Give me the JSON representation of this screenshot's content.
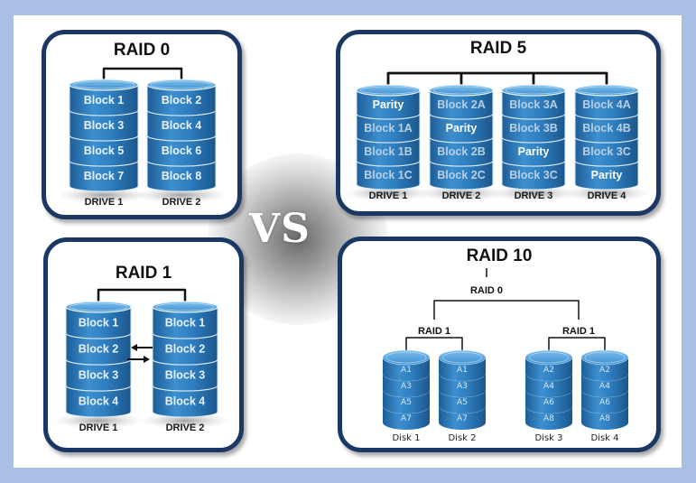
{
  "vs_label": "VS",
  "colors": {
    "frame": "#a9bfe3",
    "box_border": "#1b3864",
    "cylinder_body": "#2f7fc0",
    "cylinder_light": "#5ba7de",
    "cylinder_dark": "#1b5f98",
    "parity_text": "#ffffff",
    "block_text_raid5": "#b9cfe3"
  },
  "raid0": {
    "title": "RAID 0",
    "drives": [
      {
        "label": "DRIVE 1",
        "blocks": [
          "Block 1",
          "Block 3",
          "Block 5",
          "Block 7"
        ]
      },
      {
        "label": "DRIVE 2",
        "blocks": [
          "Block 2",
          "Block 4",
          "Block 6",
          "Block 8"
        ]
      }
    ]
  },
  "raid5": {
    "title": "RAID 5",
    "drives": [
      {
        "label": "DRIVE 1",
        "blocks": [
          "Parity",
          "Block 1A",
          "Block 1B",
          "Block 1C"
        ]
      },
      {
        "label": "DRIVE 2",
        "blocks": [
          "Block 2A",
          "Parity",
          "Block 2B",
          "Block 2C"
        ]
      },
      {
        "label": "DRIVE 3",
        "blocks": [
          "Block 3A",
          "Block 3B",
          "Parity",
          "Block 3C"
        ]
      },
      {
        "label": "DRIVE 4",
        "blocks": [
          "Block 4A",
          "Block 4B",
          "Block 3C",
          "Parity"
        ]
      }
    ]
  },
  "raid1": {
    "title": "RAID 1",
    "drives": [
      {
        "label": "DRIVE 1",
        "blocks": [
          "Block 1",
          "Block 2",
          "Block 3",
          "Block 4"
        ]
      },
      {
        "label": "DRIVE 2",
        "blocks": [
          "Block 1",
          "Block 2",
          "Block 3",
          "Block 4"
        ]
      }
    ],
    "arrows": [
      "left-arrow",
      "right-arrow"
    ]
  },
  "raid10": {
    "title": "RAID 10",
    "stripe_label": "RAID 0",
    "mirror_labels": [
      "RAID 1",
      "RAID 1"
    ],
    "disks": [
      {
        "label": "Disk 1",
        "blocks": [
          "A1",
          "A3",
          "A5",
          "A7"
        ]
      },
      {
        "label": "Disk 2",
        "blocks": [
          "A1",
          "A3",
          "A5",
          "A7"
        ]
      },
      {
        "label": "Disk 3",
        "blocks": [
          "A2",
          "A4",
          "A6",
          "A8"
        ]
      },
      {
        "label": "Disk 4",
        "blocks": [
          "A2",
          "A4",
          "A6",
          "A8"
        ]
      }
    ]
  }
}
